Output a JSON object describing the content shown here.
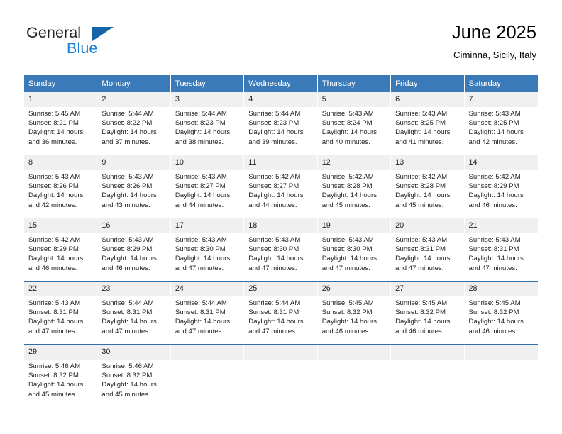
{
  "brand": {
    "name_part1": "General",
    "name_part2": "Blue",
    "logo_icon": "blue-triangle-icon",
    "colors": {
      "dark": "#231f20",
      "blue": "#1a7fd4",
      "triangle": "#1565a8"
    }
  },
  "header": {
    "title": "June 2025",
    "subtitle": "Ciminna, Sicily, Italy"
  },
  "theme": {
    "header_row_bg": "#3a7ab8",
    "header_row_text": "#ffffff",
    "day_number_bg": "#f0f0f0",
    "week_divider": "#2f6fab",
    "cell_bg": "#ffffff",
    "body_text": "#222222"
  },
  "calendar": {
    "weekday_headers": [
      "Sunday",
      "Monday",
      "Tuesday",
      "Wednesday",
      "Thursday",
      "Friday",
      "Saturday"
    ],
    "weeks": [
      [
        {
          "day": "1",
          "sunrise": "Sunrise: 5:45 AM",
          "sunset": "Sunset: 8:21 PM",
          "daylight_line1": "Daylight: 14 hours",
          "daylight_line2": "and 36 minutes."
        },
        {
          "day": "2",
          "sunrise": "Sunrise: 5:44 AM",
          "sunset": "Sunset: 8:22 PM",
          "daylight_line1": "Daylight: 14 hours",
          "daylight_line2": "and 37 minutes."
        },
        {
          "day": "3",
          "sunrise": "Sunrise: 5:44 AM",
          "sunset": "Sunset: 8:23 PM",
          "daylight_line1": "Daylight: 14 hours",
          "daylight_line2": "and 38 minutes."
        },
        {
          "day": "4",
          "sunrise": "Sunrise: 5:44 AM",
          "sunset": "Sunset: 8:23 PM",
          "daylight_line1": "Daylight: 14 hours",
          "daylight_line2": "and 39 minutes."
        },
        {
          "day": "5",
          "sunrise": "Sunrise: 5:43 AM",
          "sunset": "Sunset: 8:24 PM",
          "daylight_line1": "Daylight: 14 hours",
          "daylight_line2": "and 40 minutes."
        },
        {
          "day": "6",
          "sunrise": "Sunrise: 5:43 AM",
          "sunset": "Sunset: 8:25 PM",
          "daylight_line1": "Daylight: 14 hours",
          "daylight_line2": "and 41 minutes."
        },
        {
          "day": "7",
          "sunrise": "Sunrise: 5:43 AM",
          "sunset": "Sunset: 8:25 PM",
          "daylight_line1": "Daylight: 14 hours",
          "daylight_line2": "and 42 minutes."
        }
      ],
      [
        {
          "day": "8",
          "sunrise": "Sunrise: 5:43 AM",
          "sunset": "Sunset: 8:26 PM",
          "daylight_line1": "Daylight: 14 hours",
          "daylight_line2": "and 42 minutes."
        },
        {
          "day": "9",
          "sunrise": "Sunrise: 5:43 AM",
          "sunset": "Sunset: 8:26 PM",
          "daylight_line1": "Daylight: 14 hours",
          "daylight_line2": "and 43 minutes."
        },
        {
          "day": "10",
          "sunrise": "Sunrise: 5:43 AM",
          "sunset": "Sunset: 8:27 PM",
          "daylight_line1": "Daylight: 14 hours",
          "daylight_line2": "and 44 minutes."
        },
        {
          "day": "11",
          "sunrise": "Sunrise: 5:42 AM",
          "sunset": "Sunset: 8:27 PM",
          "daylight_line1": "Daylight: 14 hours",
          "daylight_line2": "and 44 minutes."
        },
        {
          "day": "12",
          "sunrise": "Sunrise: 5:42 AM",
          "sunset": "Sunset: 8:28 PM",
          "daylight_line1": "Daylight: 14 hours",
          "daylight_line2": "and 45 minutes."
        },
        {
          "day": "13",
          "sunrise": "Sunrise: 5:42 AM",
          "sunset": "Sunset: 8:28 PM",
          "daylight_line1": "Daylight: 14 hours",
          "daylight_line2": "and 45 minutes."
        },
        {
          "day": "14",
          "sunrise": "Sunrise: 5:42 AM",
          "sunset": "Sunset: 8:29 PM",
          "daylight_line1": "Daylight: 14 hours",
          "daylight_line2": "and 46 minutes."
        }
      ],
      [
        {
          "day": "15",
          "sunrise": "Sunrise: 5:42 AM",
          "sunset": "Sunset: 8:29 PM",
          "daylight_line1": "Daylight: 14 hours",
          "daylight_line2": "and 46 minutes."
        },
        {
          "day": "16",
          "sunrise": "Sunrise: 5:43 AM",
          "sunset": "Sunset: 8:29 PM",
          "daylight_line1": "Daylight: 14 hours",
          "daylight_line2": "and 46 minutes."
        },
        {
          "day": "17",
          "sunrise": "Sunrise: 5:43 AM",
          "sunset": "Sunset: 8:30 PM",
          "daylight_line1": "Daylight: 14 hours",
          "daylight_line2": "and 47 minutes."
        },
        {
          "day": "18",
          "sunrise": "Sunrise: 5:43 AM",
          "sunset": "Sunset: 8:30 PM",
          "daylight_line1": "Daylight: 14 hours",
          "daylight_line2": "and 47 minutes."
        },
        {
          "day": "19",
          "sunrise": "Sunrise: 5:43 AM",
          "sunset": "Sunset: 8:30 PM",
          "daylight_line1": "Daylight: 14 hours",
          "daylight_line2": "and 47 minutes."
        },
        {
          "day": "20",
          "sunrise": "Sunrise: 5:43 AM",
          "sunset": "Sunset: 8:31 PM",
          "daylight_line1": "Daylight: 14 hours",
          "daylight_line2": "and 47 minutes."
        },
        {
          "day": "21",
          "sunrise": "Sunrise: 5:43 AM",
          "sunset": "Sunset: 8:31 PM",
          "daylight_line1": "Daylight: 14 hours",
          "daylight_line2": "and 47 minutes."
        }
      ],
      [
        {
          "day": "22",
          "sunrise": "Sunrise: 5:43 AM",
          "sunset": "Sunset: 8:31 PM",
          "daylight_line1": "Daylight: 14 hours",
          "daylight_line2": "and 47 minutes."
        },
        {
          "day": "23",
          "sunrise": "Sunrise: 5:44 AM",
          "sunset": "Sunset: 8:31 PM",
          "daylight_line1": "Daylight: 14 hours",
          "daylight_line2": "and 47 minutes."
        },
        {
          "day": "24",
          "sunrise": "Sunrise: 5:44 AM",
          "sunset": "Sunset: 8:31 PM",
          "daylight_line1": "Daylight: 14 hours",
          "daylight_line2": "and 47 minutes."
        },
        {
          "day": "25",
          "sunrise": "Sunrise: 5:44 AM",
          "sunset": "Sunset: 8:31 PM",
          "daylight_line1": "Daylight: 14 hours",
          "daylight_line2": "and 47 minutes."
        },
        {
          "day": "26",
          "sunrise": "Sunrise: 5:45 AM",
          "sunset": "Sunset: 8:32 PM",
          "daylight_line1": "Daylight: 14 hours",
          "daylight_line2": "and 46 minutes."
        },
        {
          "day": "27",
          "sunrise": "Sunrise: 5:45 AM",
          "sunset": "Sunset: 8:32 PM",
          "daylight_line1": "Daylight: 14 hours",
          "daylight_line2": "and 46 minutes."
        },
        {
          "day": "28",
          "sunrise": "Sunrise: 5:45 AM",
          "sunset": "Sunset: 8:32 PM",
          "daylight_line1": "Daylight: 14 hours",
          "daylight_line2": "and 46 minutes."
        }
      ],
      [
        {
          "day": "29",
          "sunrise": "Sunrise: 5:46 AM",
          "sunset": "Sunset: 8:32 PM",
          "daylight_line1": "Daylight: 14 hours",
          "daylight_line2": "and 45 minutes."
        },
        {
          "day": "30",
          "sunrise": "Sunrise: 5:46 AM",
          "sunset": "Sunset: 8:32 PM",
          "daylight_line1": "Daylight: 14 hours",
          "daylight_line2": "and 45 minutes."
        },
        {
          "day": "",
          "sunrise": "",
          "sunset": "",
          "daylight_line1": "",
          "daylight_line2": ""
        },
        {
          "day": "",
          "sunrise": "",
          "sunset": "",
          "daylight_line1": "",
          "daylight_line2": ""
        },
        {
          "day": "",
          "sunrise": "",
          "sunset": "",
          "daylight_line1": "",
          "daylight_line2": ""
        },
        {
          "day": "",
          "sunrise": "",
          "sunset": "",
          "daylight_line1": "",
          "daylight_line2": ""
        },
        {
          "day": "",
          "sunrise": "",
          "sunset": "",
          "daylight_line1": "",
          "daylight_line2": ""
        }
      ]
    ]
  }
}
